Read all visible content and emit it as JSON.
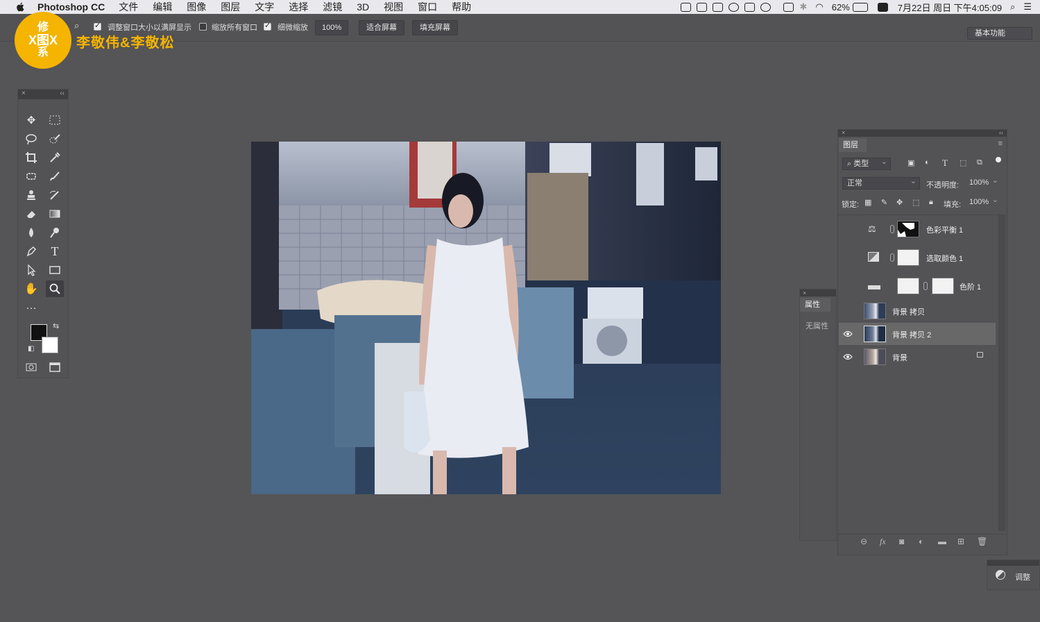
{
  "menubar": {
    "app_name": "Photoshop CC",
    "menus": [
      "文件",
      "编辑",
      "图像",
      "图层",
      "文字",
      "选择",
      "滤镜",
      "3D",
      "视图",
      "窗口",
      "帮助"
    ],
    "battery": "62%",
    "datetime": "7月22日 周日 下午4:05:09"
  },
  "options_bar": {
    "resize_windows_label": "调整窗口大小以满屏显示",
    "zoom_all_windows_label": "缩放所有窗口",
    "scrubby_zoom_label": "细微缩放",
    "zoom_value": "100%",
    "fit_screen_label": "适合屏幕",
    "fill_screen_label": "填充屏幕",
    "workspace": "基本功能"
  },
  "watermark": {
    "logo_text": [
      "修",
      "X图X",
      "系"
    ],
    "brand": "李敬伟&李敬松"
  },
  "properties_panel": {
    "title": "属性",
    "empty_text": "无属性"
  },
  "layers_panel": {
    "title": "图层",
    "filter_label": "类型",
    "blend_mode": "正常",
    "opacity_label": "不透明度:",
    "opacity_value": "100%",
    "lock_label": "锁定:",
    "fill_label": "填充:",
    "fill_value": "100%",
    "layers": [
      {
        "name": "色彩平衡 1",
        "visible": false
      },
      {
        "name": "选取颜色 1",
        "visible": false
      },
      {
        "name": "色阶 1",
        "visible": false
      },
      {
        "name": "背景 拷贝",
        "visible": false
      },
      {
        "name": "背景 拷贝 2",
        "visible": true,
        "selected": true
      },
      {
        "name": "背景",
        "visible": true,
        "locked": true
      }
    ]
  },
  "adjustments_panel": {
    "title": "调整"
  }
}
